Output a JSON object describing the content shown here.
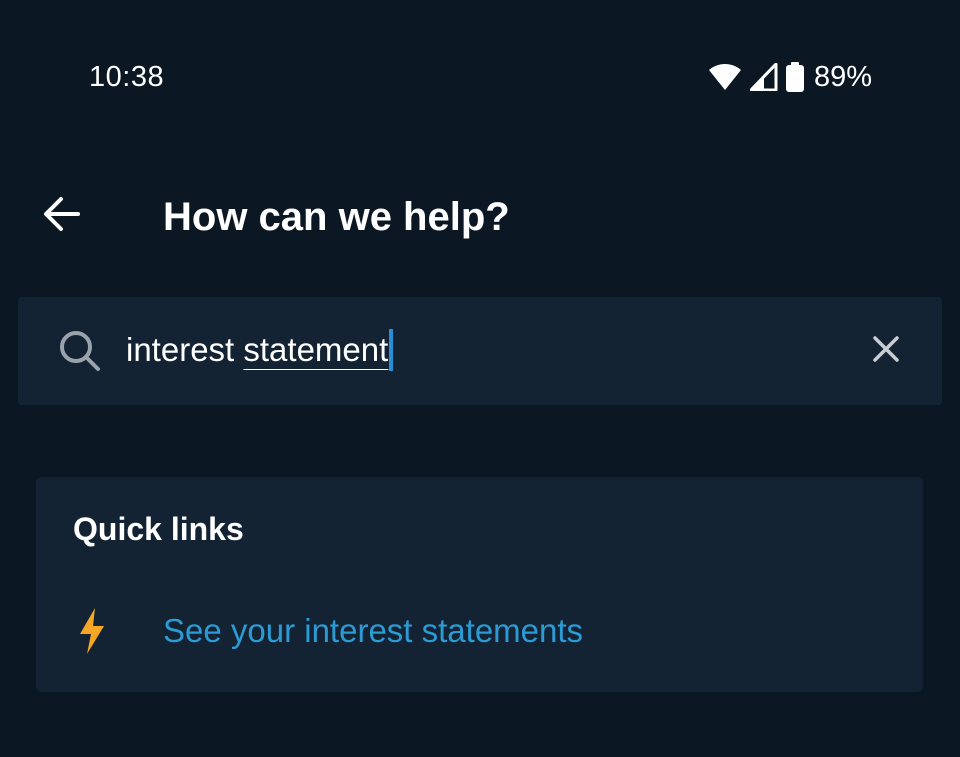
{
  "status_bar": {
    "time": "10:38",
    "battery": "89%",
    "icons": [
      "wifi-icon",
      "cell-signal-icon",
      "battery-icon"
    ]
  },
  "app_bar": {
    "back_icon": "arrow-left-icon",
    "title": "How can we help?"
  },
  "search": {
    "icon": "search-icon",
    "value_plain": "interest ",
    "value_composing": "statement",
    "clear_icon": "close-icon"
  },
  "quick_links": {
    "title": "Quick links",
    "items": [
      {
        "icon": "lightning-bolt-icon",
        "label": "See your interest statements"
      }
    ]
  },
  "colors": {
    "background": "#0b1824",
    "surface": "#132334",
    "link": "#2c9ad3",
    "caret": "#2a8fd0",
    "bolt": "#f5a623"
  }
}
